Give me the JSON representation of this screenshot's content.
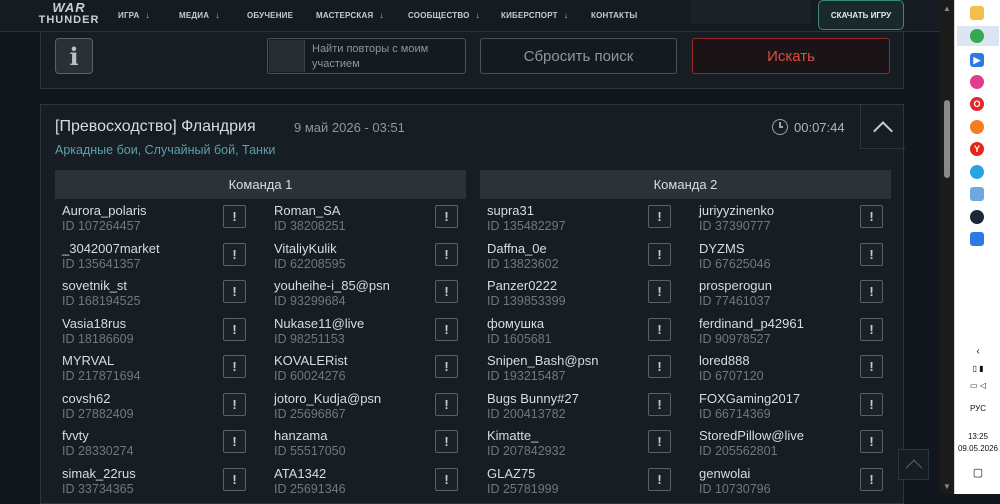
{
  "nav": {
    "logo_line1": "WAR",
    "logo_line2": "THUNDER",
    "items": [
      {
        "label": "ИГРА",
        "has_arrow": true,
        "icon": "chevron-down-icon"
      },
      {
        "label": "МЕДИА",
        "has_arrow": true,
        "icon": "chevron-down-icon"
      },
      {
        "label": "ОБУЧЕНИЕ",
        "has_arrow": false
      },
      {
        "label": "МАСТЕРСКАЯ",
        "has_arrow": true,
        "icon": "chevron-down-icon"
      },
      {
        "label": "СООБЩЕСТВО",
        "has_arrow": true,
        "icon": "chevron-down-icon"
      },
      {
        "label": "КИБЕРСПОРТ",
        "has_arrow": true,
        "icon": "chevron-down-icon"
      },
      {
        "label": "КОНТАКТЫ",
        "has_arrow": false
      }
    ],
    "download": "СКАЧАТЬ ИГРУ"
  },
  "search": {
    "info_icon": "info-icon",
    "my_replays_label": "Найти повторы с моим участием",
    "reset": "Сбросить поиск",
    "submit": "Искать"
  },
  "replay": {
    "title": "[Превосходство] Фландрия",
    "date": "9 май 2026 - 03:51",
    "duration": "00:07:44",
    "clock_icon": "clock-icon",
    "collapse_icon": "chevron-up-icon",
    "subtitle": "Аркадные бои, Случайный бой, Танки",
    "report_icon": "report-exclamation-icon",
    "teams": [
      {
        "name": "Команда 1",
        "players": [
          {
            "name": "Aurora_polaris",
            "id": "ID 107264457"
          },
          {
            "name": "Roman_SA",
            "id": "ID 38208251"
          },
          {
            "name": "_3042007market",
            "id": "ID 135641357"
          },
          {
            "name": "VitaliyKulik",
            "id": "ID 62208595"
          },
          {
            "name": "sovetnik_st",
            "id": "ID 168194525"
          },
          {
            "name": "youheihe-i_85@psn",
            "id": "ID 93299684"
          },
          {
            "name": "Vasia18rus",
            "id": "ID 18186609"
          },
          {
            "name": "Nukase11@live",
            "id": "ID 98251153"
          },
          {
            "name": "MYRVAL",
            "id": "ID 217871694"
          },
          {
            "name": "KOVALERist",
            "id": "ID 60024276"
          },
          {
            "name": "covsh62",
            "id": "ID 27882409"
          },
          {
            "name": "jotoro_Kudja@psn",
            "id": "ID 25696867"
          },
          {
            "name": "fvvty",
            "id": "ID 28330274"
          },
          {
            "name": "hanzama",
            "id": "ID 55517050"
          },
          {
            "name": "simak_22rus",
            "id": "ID 33734365"
          },
          {
            "name": "ATA1342",
            "id": "ID 25691346"
          }
        ]
      },
      {
        "name": "Команда 2",
        "players": [
          {
            "name": "supra31",
            "id": "ID 135482297"
          },
          {
            "name": "juriyyzinenko",
            "id": "ID 37390777"
          },
          {
            "name": "Daffna_0e",
            "id": "ID 13823602"
          },
          {
            "name": "DYZMS",
            "id": "ID 67625046"
          },
          {
            "name": "Panzer0222",
            "id": "ID 139853399"
          },
          {
            "name": "prosperogun",
            "id": "ID 77461037"
          },
          {
            "name": "фомушка",
            "id": "ID 1605681"
          },
          {
            "name": "ferdinand_p42961",
            "id": "ID 90978527"
          },
          {
            "name": "Snipen_Bash@psn",
            "id": "ID 193215487"
          },
          {
            "name": "lored888",
            "id": "ID 6707120"
          },
          {
            "name": "Bugs Bunny#27",
            "id": "ID 200413782"
          },
          {
            "name": "FOXGaming2017",
            "id": "ID 66714369"
          },
          {
            "name": "Kimatte_",
            "id": "ID 207842932"
          },
          {
            "name": "StoredPillow@live",
            "id": "ID 205562801"
          },
          {
            "name": "GLAZ75",
            "id": "ID 25781999"
          },
          {
            "name": "genwolai",
            "id": "ID 10730796"
          }
        ]
      }
    ]
  },
  "taskbar": {
    "lang": "РУС",
    "time": "13:25",
    "date": "09.05.2026",
    "icons": [
      "files-icon",
      "chrome-icon",
      "play-icon",
      "colorful-app-icon",
      "opera-icon",
      "firefox-icon",
      "yandex-icon",
      "telegram-icon",
      "notes-icon",
      "steam-icon",
      "camera-icon"
    ]
  }
}
